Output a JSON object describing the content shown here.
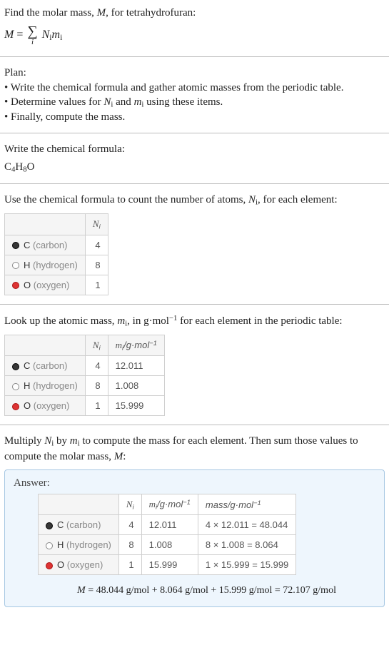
{
  "intro": {
    "line1_pre": "Find the molar mass, ",
    "line1_Mital": "M",
    "line1_post": ", for tetrahydrofuran:",
    "eq_M": "M",
    "eq_eq": " = ",
    "eq_sigma": "∑",
    "eq_sum_lower": "i",
    "eq_Ni": "N",
    "eq_Ni_sub": "i",
    "eq_mi": "m",
    "eq_mi_sub": "i"
  },
  "plan": {
    "heading": "Plan:",
    "b1_pre": "• Write the chemical formula and gather atomic masses from the periodic table.",
    "b2_pre": "• Determine values for ",
    "b2_Ni": "N",
    "b2_Ni_sub": "i",
    "b2_mid": " and ",
    "b2_mi": "m",
    "b2_mi_sub": "i",
    "b2_post": " using these items.",
    "b3": "• Finally, compute the mass."
  },
  "chem": {
    "heading": "Write the chemical formula:",
    "c_C": "C",
    "c_4": "4",
    "c_H": "H",
    "c_8": "8",
    "c_O": "O"
  },
  "count": {
    "line_pre": "Use the chemical formula to count the number of atoms, ",
    "line_Ni": "N",
    "line_Ni_sub": "i",
    "line_post": ", for each element:",
    "th_blank": " ",
    "th_Ni": "N",
    "th_Ni_sub": "i",
    "rows": [
      {
        "swatchClass": "c-carbon",
        "elem": "C",
        "ename": "(carbon)",
        "n": "4"
      },
      {
        "swatchClass": "c-hydrogen",
        "elem": "H",
        "ename": "(hydrogen)",
        "n": "8"
      },
      {
        "swatchClass": "c-oxygen",
        "elem": "O",
        "ename": "(oxygen)",
        "n": "1"
      }
    ]
  },
  "mass": {
    "line_pre": "Look up the atomic mass, ",
    "line_mi": "m",
    "line_mi_sub": "i",
    "line_mid": ", in g·mol",
    "line_exp": "−1",
    "line_post": " for each element in the periodic table:",
    "th_blank": " ",
    "th_Ni": "N",
    "th_Ni_sub": "i",
    "th_mi": "m",
    "th_mi_sub": "i",
    "th_mi_unit": "/g·mol",
    "th_mi_exp": "−1",
    "rows": [
      {
        "swatchClass": "c-carbon",
        "elem": "C",
        "ename": "(carbon)",
        "n": "4",
        "m": "12.011"
      },
      {
        "swatchClass": "c-hydrogen",
        "elem": "H",
        "ename": "(hydrogen)",
        "n": "8",
        "m": "1.008"
      },
      {
        "swatchClass": "c-oxygen",
        "elem": "O",
        "ename": "(oxygen)",
        "n": "1",
        "m": "15.999"
      }
    ]
  },
  "compute": {
    "line_pre": "Multiply ",
    "line_Ni": "N",
    "line_Ni_sub": "i",
    "line_mid1": " by ",
    "line_mi": "m",
    "line_mi_sub": "i",
    "line_mid2": " to compute the mass for each element. Then sum those values to compute the molar mass, ",
    "line_M": "M",
    "line_post": ":"
  },
  "answer": {
    "label": "Answer:",
    "th_blank": " ",
    "th_Ni": "N",
    "th_Ni_sub": "i",
    "th_mi": "m",
    "th_mi_sub": "i",
    "th_mi_unit": "/g·mol",
    "th_mi_exp": "−1",
    "th_mass": "mass/g·mol",
    "th_mass_exp": "−1",
    "rows": [
      {
        "swatchClass": "c-carbon",
        "elem": "C",
        "ename": "(carbon)",
        "n": "4",
        "m": "12.011",
        "mass": "4 × 12.011 = 48.044"
      },
      {
        "swatchClass": "c-hydrogen",
        "elem": "H",
        "ename": "(hydrogen)",
        "n": "8",
        "m": "1.008",
        "mass": "8 × 1.008 = 8.064"
      },
      {
        "swatchClass": "c-oxygen",
        "elem": "O",
        "ename": "(oxygen)",
        "n": "1",
        "m": "15.999",
        "mass": "1 × 15.999 = 15.999"
      }
    ],
    "final_M": "M",
    "final_eq": " = 48.044 g/mol + 8.064 g/mol + 15.999 g/mol = 72.107 g/mol"
  }
}
